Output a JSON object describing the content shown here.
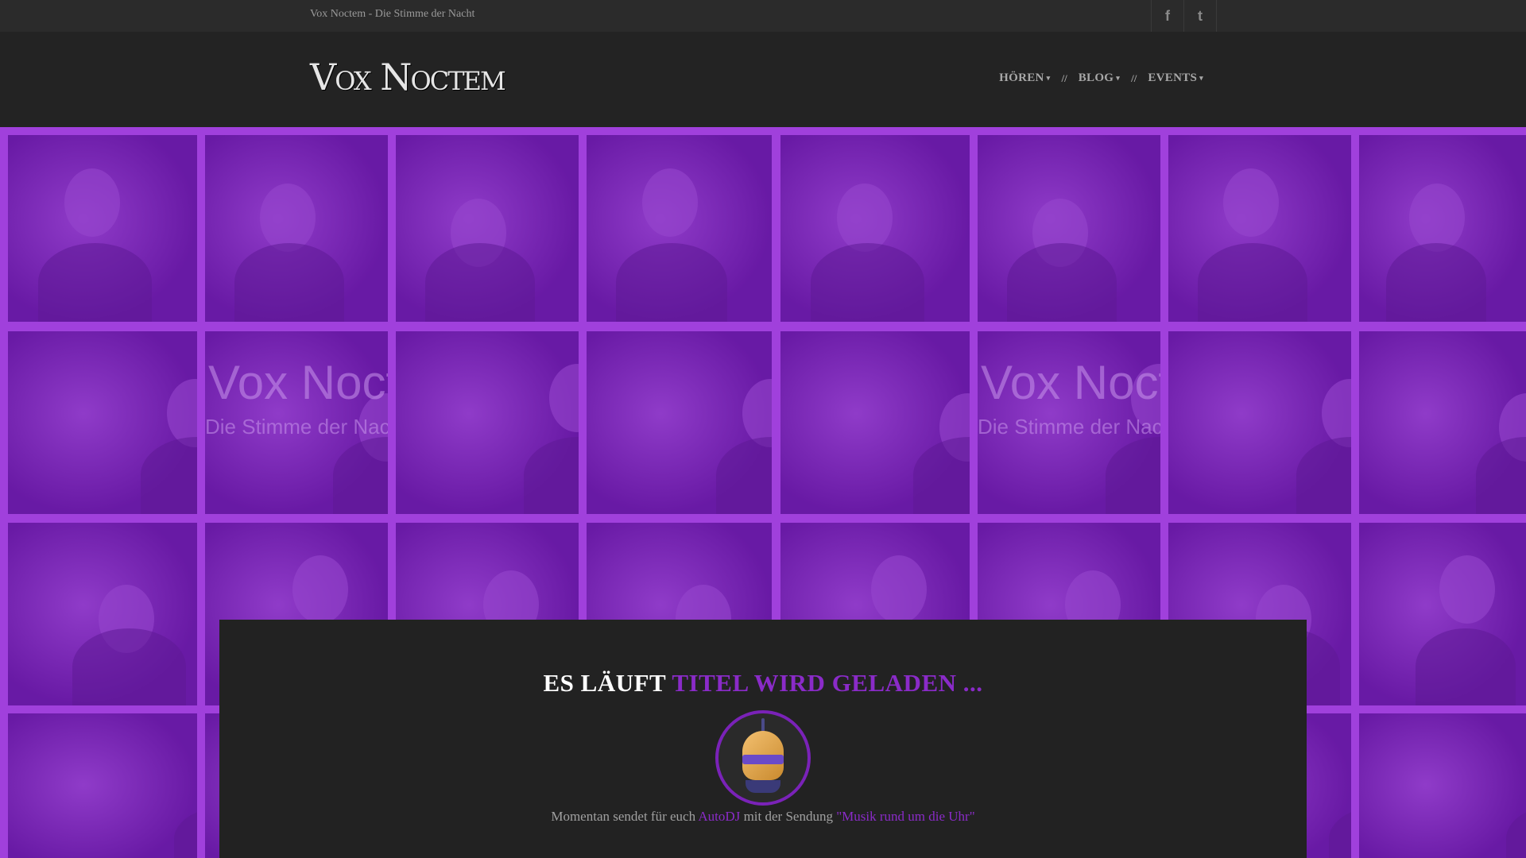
{
  "topbar": {
    "tagline": "Vox Noctem - Die Stimme der Nacht",
    "social": [
      {
        "name": "facebook-icon",
        "glyph": "f"
      },
      {
        "name": "twitter-icon",
        "glyph": "t"
      }
    ]
  },
  "header": {
    "logo": "Vox Noctem",
    "nav": [
      {
        "label": "HÖREN"
      },
      {
        "label": "BLOG"
      },
      {
        "label": "EVENTS"
      }
    ],
    "nav_separator": "//",
    "nav_caret": "▾"
  },
  "gallery": {
    "tile_texts": {
      "banner_logo": "Vox Noctem",
      "banner_sub": "Die Stimme der Nacht"
    }
  },
  "player": {
    "now_label": "ES LÄUFT",
    "now_track": "TITEL WIRD GELADEN ...",
    "info_prefix": "Momentan sendet für euch",
    "dj": "AutoDJ",
    "info_middle": "mit der Sendung",
    "show": "\"Musik rund um die Uhr\""
  },
  "colors": {
    "accent": "#8a2bc8",
    "topbar": "#2b2b2b",
    "header": "#232323",
    "panel": "#222222"
  }
}
